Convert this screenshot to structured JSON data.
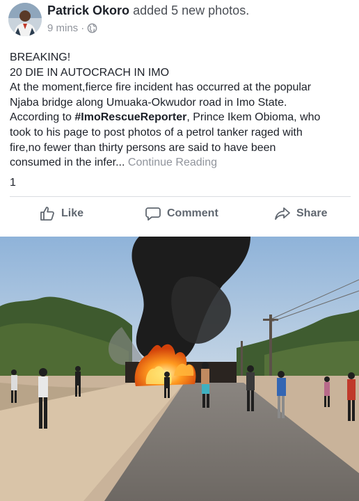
{
  "post": {
    "author": "Patrick Okoro",
    "action": "added 5 new photos.",
    "time": "9 mins",
    "separator": "·",
    "privacy_icon": "globe-icon",
    "headline": "BREAKING!",
    "subheadline": "20 DIE IN AUTOCRACH IN IMO",
    "body_line_1": "At the moment,fierce fire incident has occurred at the popular",
    "body_line_2": "Njaba bridge along Umuaka-Okwudor road in Imo State.",
    "body_line_3_pre": "According to ",
    "hashtag": "#ImoRescueReporter",
    "body_line_3_post": ", Prince Ikem Obioma, who",
    "body_line_4": "took to his page to post photos of a petrol tanker raged with",
    "body_line_5": "fire,no fewer than thirty persons are said to have been",
    "body_line_6": "consumed in the infer...",
    "continue_reading": "Continue Reading",
    "reaction_count": "1"
  },
  "actions": {
    "like": "Like",
    "comment": "Comment",
    "share": "Share",
    "like_icon": "thumbs-up-icon",
    "comment_icon": "comment-bubble-icon",
    "share_icon": "share-arrow-icon"
  },
  "colors": {
    "text": "#1d2129",
    "secondary": "#90949c",
    "action": "#606770",
    "divider": "#dadde1"
  }
}
